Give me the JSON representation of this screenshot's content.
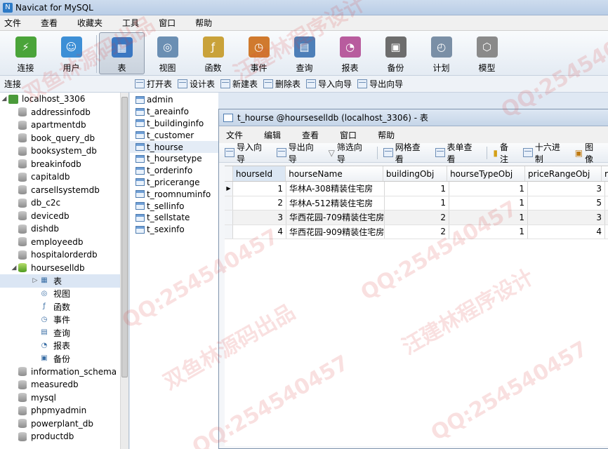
{
  "window": {
    "title": "Navicat for MySQL"
  },
  "menubar": [
    "文件",
    "查看",
    "收藏夹",
    "工具",
    "窗口",
    "帮助"
  ],
  "toolbar": [
    {
      "label": "连接",
      "icon": "connection-icon",
      "color": "#4aa43a"
    },
    {
      "label": "用户",
      "icon": "user-icon",
      "color": "#3d8fd6"
    },
    {
      "label": "表",
      "icon": "table-icon",
      "color": "#3b78c2",
      "active": true
    },
    {
      "label": "视图",
      "icon": "view-icon",
      "color": "#6b8fb3"
    },
    {
      "label": "函数",
      "icon": "function-icon",
      "color": "#c9a23a"
    },
    {
      "label": "事件",
      "icon": "event-icon",
      "color": "#d07a2e"
    },
    {
      "label": "查询",
      "icon": "query-icon",
      "color": "#4d7fb8"
    },
    {
      "label": "报表",
      "icon": "report-icon",
      "color": "#b85c9e"
    },
    {
      "label": "备份",
      "icon": "backup-icon",
      "color": "#6d6d6d"
    },
    {
      "label": "计划",
      "icon": "schedule-icon",
      "color": "#7a8fa6"
    },
    {
      "label": "模型",
      "icon": "model-icon",
      "color": "#8a8a8a"
    }
  ],
  "subbar": {
    "conn_label": "连接",
    "actions": [
      "打开表",
      "设计表",
      "新建表",
      "删除表",
      "导入向导",
      "导出向导"
    ]
  },
  "tree": {
    "server": "localhost_3306",
    "dbs_before": [
      "addressinfodb",
      "apartmentdb",
      "book_query_db",
      "booksystem_db",
      "breakinfodb",
      "capitaldb",
      "carsellsystemdb",
      "db_c2c",
      "devicedb",
      "dishdb",
      "employeedb",
      "hospitalorderdb"
    ],
    "open_db": "hourseselldb",
    "children": [
      "表",
      "视图",
      "函数",
      "事件",
      "查询",
      "报表",
      "备份"
    ],
    "dbs_after": [
      "information_schema",
      "measuredb",
      "mysql",
      "phpmyadmin",
      "powerplant_db",
      "productdb"
    ]
  },
  "objects": [
    "admin",
    "t_areainfo",
    "t_buildinginfo",
    "t_customer",
    "t_hourse",
    "t_hoursetype",
    "t_orderinfo",
    "t_pricerange",
    "t_roomnuminfo",
    "t_sellinfo",
    "t_sellstate",
    "t_sexinfo"
  ],
  "tablewin": {
    "title": "t_hourse @hourseselldb (localhost_3306) - 表",
    "menu": [
      "文件",
      "编辑",
      "查看",
      "窗口",
      "帮助"
    ],
    "tools": [
      "导入向导",
      "导出向导",
      "筛选向导",
      "网格查看",
      "表单查看",
      "备注",
      "十六进制",
      "图像"
    ],
    "columns": [
      "hourseId",
      "hourseName",
      "buildingObj",
      "hourseTypeObj",
      "priceRangeObj"
    ],
    "rows": [
      [
        "1",
        "华林A-308精装住宅房",
        "1",
        "1",
        "3"
      ],
      [
        "2",
        "华林A-512精装住宅房",
        "1",
        "1",
        "5"
      ],
      [
        "3",
        "华西花园-709精装住宅房",
        "2",
        "1",
        "3"
      ],
      [
        "4",
        "华西花园-909精装住宅房",
        "2",
        "1",
        "4"
      ]
    ]
  },
  "watermarks": [
    "QQ:254540457",
    "双鱼林源码出品",
    "汪建林程序设计"
  ]
}
